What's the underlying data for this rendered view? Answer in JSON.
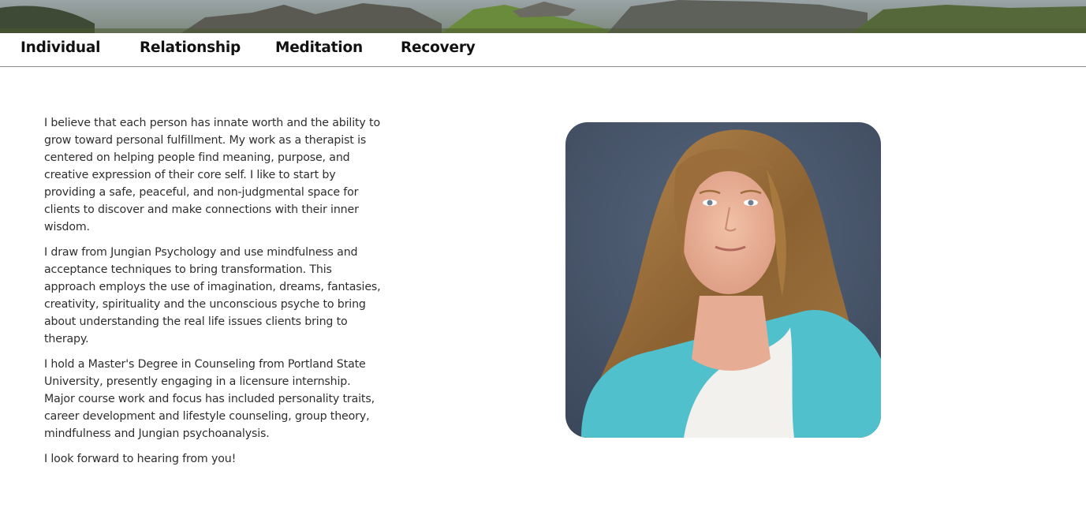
{
  "banner": {
    "image": "mountain-landscape-banner"
  },
  "nav": {
    "items": [
      {
        "label": "Individual"
      },
      {
        "label": "Relationship"
      },
      {
        "label": "Meditation"
      },
      {
        "label": "Recovery"
      }
    ]
  },
  "main": {
    "paragraphs": [
      "I believe that each person has innate worth and the ability to grow toward personal fulfillment. My work as a therapist is centered on helping people find meaning, purpose, and creative expression of their core self. I like to start by providing a safe, peaceful, and non-judgmental space for clients to discover and make connections with their inner wisdom.",
      "I draw from Jungian Psychology and use mindfulness and acceptance techniques to bring transformation. This approach employs the use of imagination, dreams, fantasies, creativity, spirituality and the unconscious psyche to bring about understanding the real life issues clients bring to therapy.",
      "I hold a Master's Degree in Counseling from Portland State University, presently engaging in a licensure internship. Major course work and focus has included personality traits, career development and lifestyle counseling, group theory, mindfulness and Jungian psychoanalysis.",
      "I look forward to hearing from you!"
    ],
    "portrait": "therapist-portrait-photo"
  },
  "colors": {
    "nav_text": "#111111",
    "body_text": "#2e2e2e",
    "divider": "#8a8a8a",
    "photo_background": "#44536a",
    "cardigan": "#4fc0cc"
  }
}
